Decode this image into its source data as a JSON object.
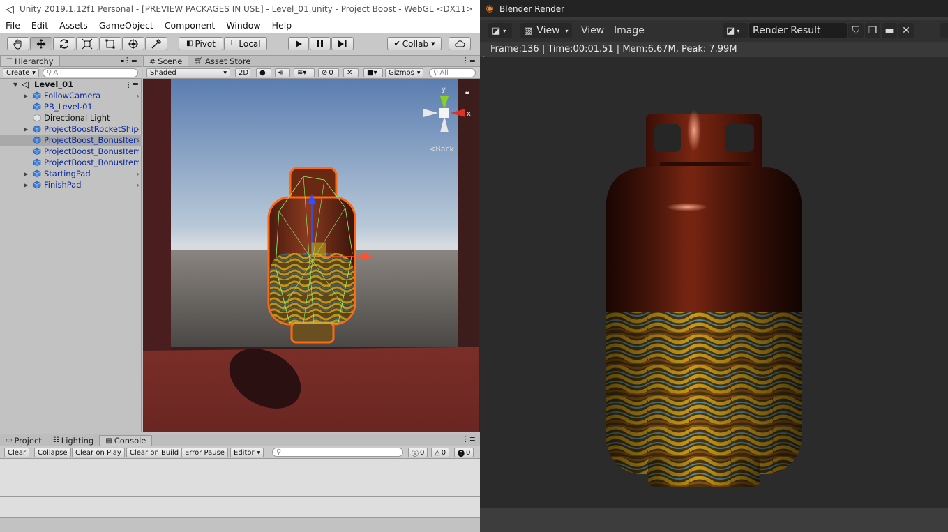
{
  "unity": {
    "title": "Unity 2019.1.12f1 Personal - [PREVIEW PACKAGES IN USE] - Level_01.unity - Project Boost - WebGL <DX11>",
    "menu": [
      "File",
      "Edit",
      "Assets",
      "GameObject",
      "Component",
      "Window",
      "Help"
    ],
    "toolbar": {
      "pivot": "Pivot",
      "local": "Local",
      "collab": "Collab",
      "tools": [
        "hand-tool-icon",
        "move-tool-icon",
        "rotate-tool-icon",
        "scale-tool-icon",
        "rect-tool-icon",
        "transform-tool-icon",
        "custom-tool-icon"
      ]
    },
    "hierarchy": {
      "tab": "Hierarchy",
      "create": "Create",
      "search_placeholder": "All",
      "scene_name": "Level_01",
      "items": [
        {
          "label": "FollowCamera",
          "expandable": true,
          "prefab": true,
          "selected": false
        },
        {
          "label": "PB_Level-01",
          "expandable": false,
          "prefab": true,
          "selected": false
        },
        {
          "label": "Directional Light",
          "expandable": false,
          "prefab": false,
          "selected": false
        },
        {
          "label": "ProjectBoostRocketShip",
          "expandable": true,
          "prefab": true,
          "selected": false
        },
        {
          "label": "ProjectBoost_BonusItem",
          "expandable": false,
          "prefab": true,
          "selected": true
        },
        {
          "label": "ProjectBoost_BonusItem",
          "expandable": false,
          "prefab": true,
          "selected": false
        },
        {
          "label": "ProjectBoost_BonusItem",
          "expandable": false,
          "prefab": true,
          "selected": false
        },
        {
          "label": "StartingPad",
          "expandable": true,
          "prefab": true,
          "selected": false
        },
        {
          "label": "FinishPad",
          "expandable": true,
          "prefab": true,
          "selected": false
        }
      ]
    },
    "scene": {
      "tabs": [
        "Scene",
        "Asset Store"
      ],
      "shading": "Shaded",
      "mode_2d": "2D",
      "hidden_count": "0",
      "gizmos": "Gizmos",
      "search_placeholder": "All",
      "back_label": "Back",
      "axis_y": "y",
      "axis_x": "x"
    },
    "console": {
      "tabs": [
        "Project",
        "Lighting",
        "Console"
      ],
      "buttons": [
        "Clear",
        "Collapse",
        "Clear on Play",
        "Clear on Build",
        "Error Pause",
        "Editor"
      ],
      "info_count": "0",
      "warn_count": "0",
      "error_count": "0"
    }
  },
  "blender": {
    "title": "Blender Render",
    "view_menu": "View",
    "menus": [
      "View",
      "Image"
    ],
    "image_name": "Render Result",
    "info": "Frame:136 | Time:00:01.51 | Mem:6.67M, Peak: 7.99M"
  }
}
